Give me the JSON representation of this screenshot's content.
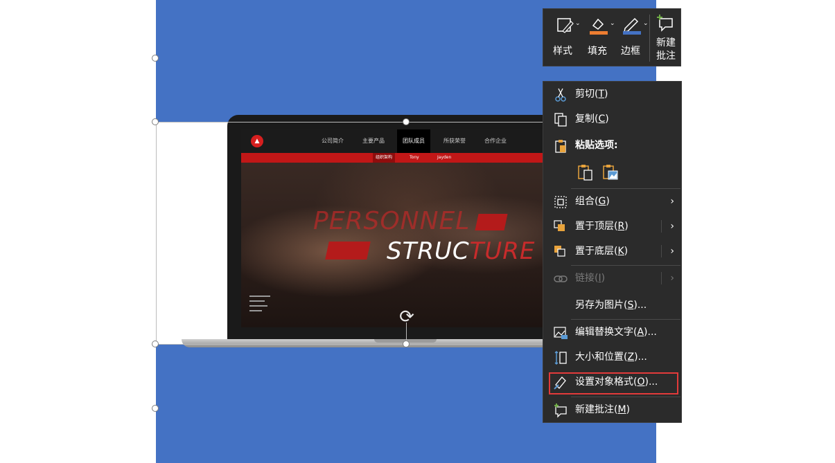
{
  "mini_toolbar": {
    "style_label": "样式",
    "fill_label": "填充",
    "border_label": "边框",
    "new_comment_line1": "新建",
    "new_comment_line2": "批注"
  },
  "context_menu": {
    "cut": {
      "label": "剪切(",
      "key": "T",
      "end": ")"
    },
    "copy": {
      "label": "复制(",
      "key": "C",
      "end": ")"
    },
    "paste_options": {
      "label": "粘贴选项:"
    },
    "group": {
      "label": "组合(",
      "key": "G",
      "end": ")"
    },
    "bring_to_front": {
      "label": "置于顶层(",
      "key": "R",
      "end": ")"
    },
    "send_to_back": {
      "label": "置于底层(",
      "key": "K",
      "end": ")"
    },
    "link": {
      "label": "链接(",
      "key": "I",
      "end": ")"
    },
    "save_as_picture": {
      "label": "另存为图片(",
      "key": "S",
      "end": ")..."
    },
    "edit_alt_text": {
      "label": "编辑替换文字(",
      "key": "A",
      "end": ")..."
    },
    "size_position": {
      "label": "大小和位置(",
      "key": "Z",
      "end": ")..."
    },
    "format_object": {
      "label": "设置对象格式(",
      "key": "O",
      "end": ")..."
    },
    "new_comment": {
      "label": "新建批注(",
      "key": "M",
      "end": ")"
    }
  },
  "slide_image": {
    "nav": [
      "公司简介",
      "主要产品",
      "团队成员",
      "所获荣誉",
      "合作企业"
    ],
    "subnav": [
      "组织架构",
      "Tony",
      "Jayden"
    ],
    "title_line1": "PERSONNEL",
    "title_line2_a": "STRUC",
    "title_line2_b": "TURE"
  },
  "colors": {
    "slide_blue": "#4472c4",
    "menu_bg": "#2b2b2b",
    "highlight_border": "#e33a3a",
    "site_red": "#c11717"
  }
}
